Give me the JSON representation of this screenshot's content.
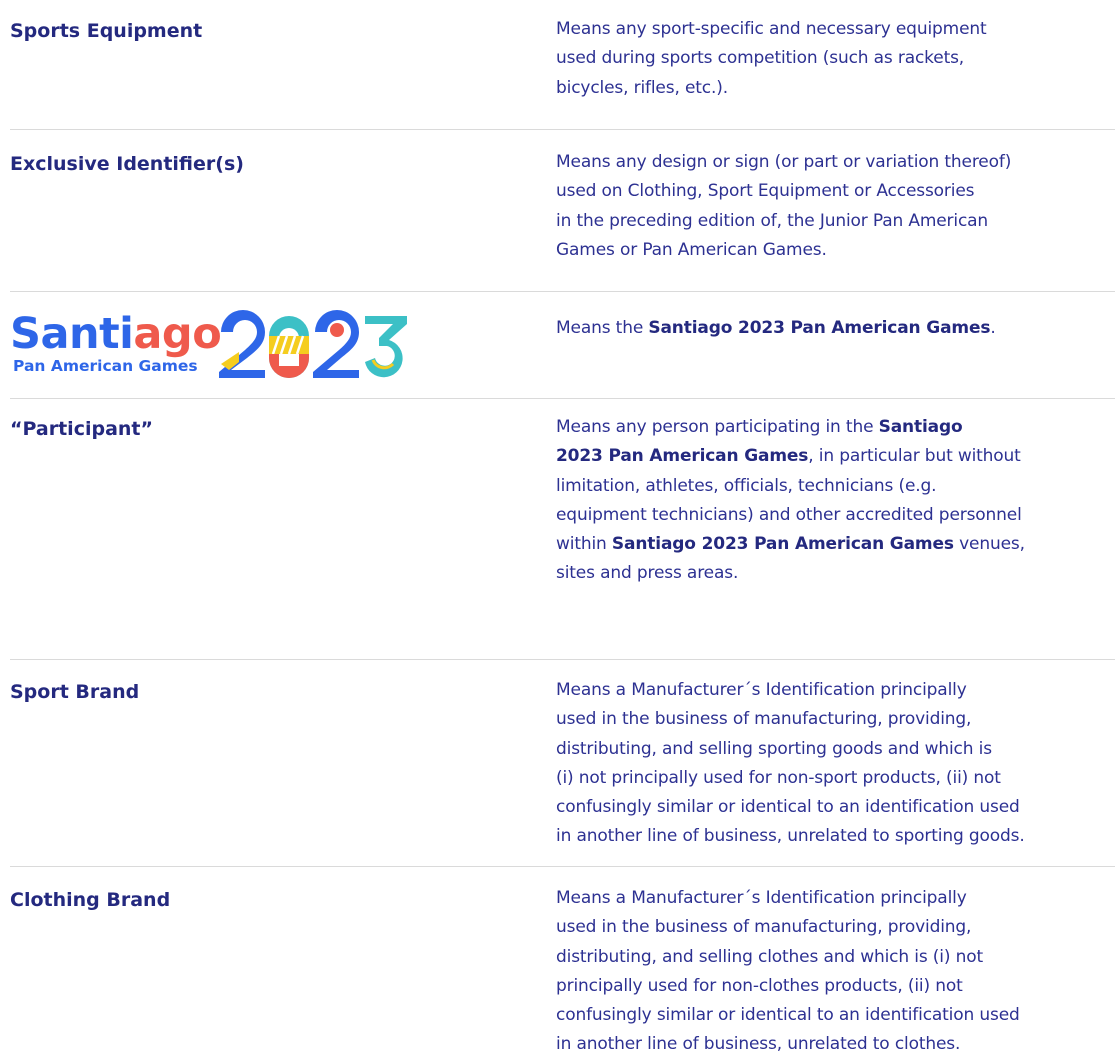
{
  "rows": [
    {
      "term": "Sports Equipment",
      "def_lines": [
        "Means any sport-specific and necessary equipment",
        "used during sports competition (such as rackets,",
        "bicycles, rifles, etc.)."
      ]
    },
    {
      "term": "Exclusive Identifier(s)",
      "def_lines": [
        "Means any design or sign (or part or variation thereof)",
        "used on Clothing, Sport Equipment or Accessories",
        "in the preceding edition of, the Junior Pan American",
        "Games or Pan American Games."
      ]
    },
    {
      "logo": {
        "word_a": "Santi",
        "word_b": "ago",
        "subtitle": "Pan American Games",
        "year": "2023"
      },
      "def_prefix": "Means the ",
      "def_bold": "Santiago 2023 Pan American Games",
      "def_suffix": "."
    },
    {
      "term": "“Participant”",
      "p1": "Means any person participating in the ",
      "p1b": "Santiago",
      "p2b": "2023 Pan American Games",
      "p2": ", in particular but without",
      "p3": "limitation, athletes, officials, technicians (e.g.",
      "p4": "equipment technicians) and other accredited personnel",
      "p5": "within ",
      "p5b": "Santiago 2023 Pan American Games",
      "p5c": " venues,",
      "p6": "sites and press areas."
    },
    {
      "term": "Sport Brand",
      "def_lines": [
        "Means a Manufacturer´s Identification principally",
        "used in the business of manufacturing, providing,",
        "distributing, and selling sporting goods and which is",
        "(i) not principally used for non-sport products, (ii) not",
        "confusingly similar or identical to an identification used",
        "in another line of business, unrelated to sporting goods."
      ]
    },
    {
      "term": "Clothing Brand",
      "def_lines": [
        "Means a Manufacturer´s Identification principally",
        "used in the business of manufacturing, providing,",
        "distributing, and selling clothes and which is (i) not",
        "principally used for non-clothes products, (ii) not",
        "confusingly similar or identical to an identification used",
        "in another line of business, unrelated to clothes."
      ]
    }
  ],
  "colors": {
    "heading": "#24297f",
    "text": "#2d3192",
    "divider": "#dadada",
    "logo_blue": "#2e66e8",
    "logo_red": "#ef5a4c",
    "logo_yellow": "#f5cd1f",
    "logo_teal": "#3cc0c6"
  }
}
